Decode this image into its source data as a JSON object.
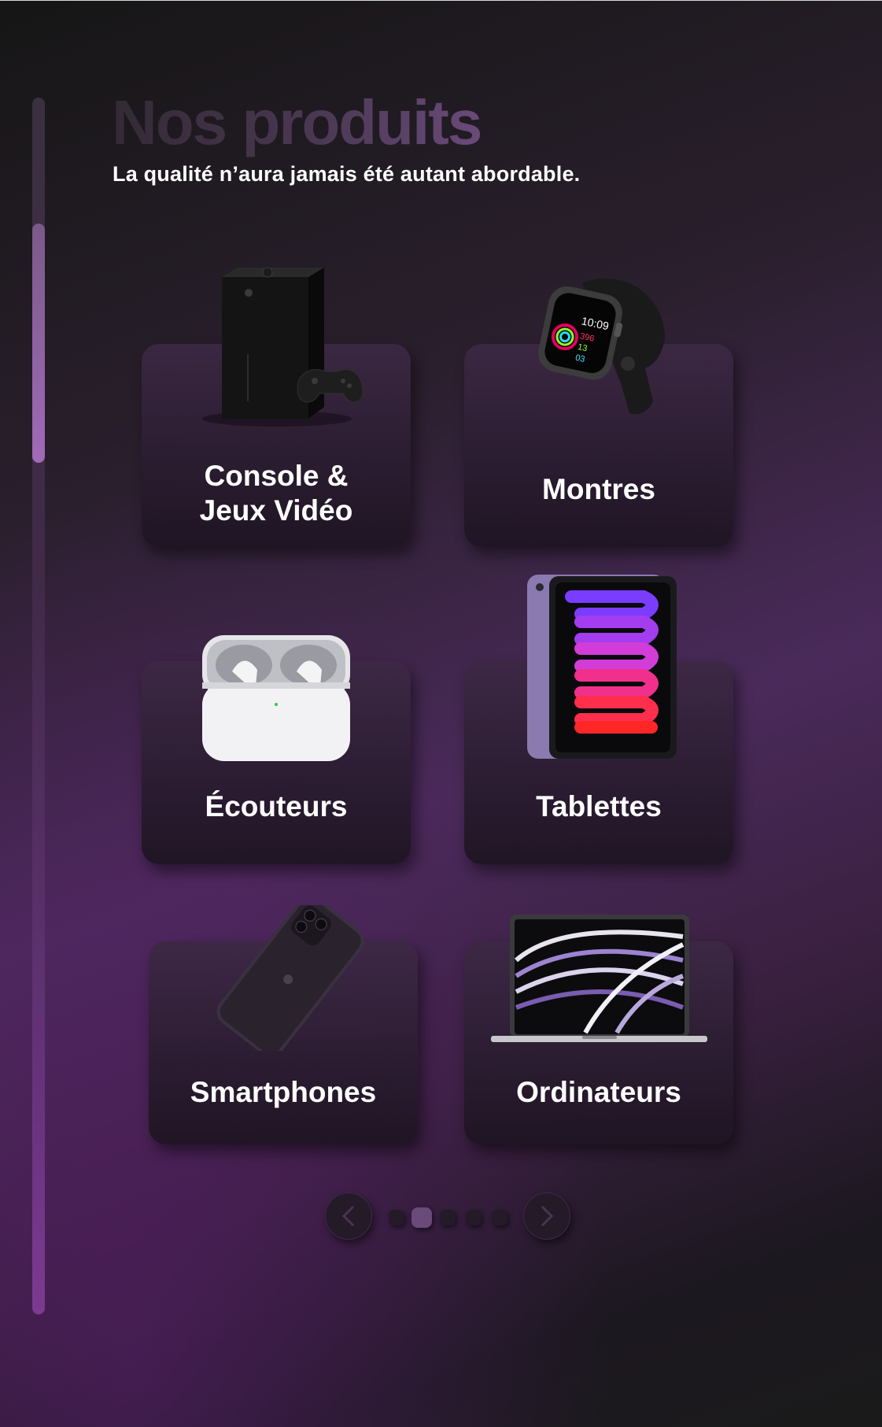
{
  "header": {
    "title": "Nos produits",
    "subtitle": "La qualité n’aura jamais été autant abordable."
  },
  "categories": [
    {
      "label": "Console &\nJeux Vidéo",
      "icon": "game-console-icon"
    },
    {
      "label": "Montres",
      "icon": "smartwatch-icon"
    },
    {
      "label": "Écouteurs",
      "icon": "earbuds-icon"
    },
    {
      "label": "Tablettes",
      "icon": "tablet-icon"
    },
    {
      "label": "Smartphones",
      "icon": "smartphone-icon"
    },
    {
      "label": "Ordinateurs",
      "icon": "laptop-icon"
    }
  ],
  "pagination": {
    "pages": 5,
    "current": 2,
    "prev_icon": "chevron-left-icon",
    "next_icon": "chevron-right-icon"
  },
  "watch_screen": {
    "time": "10:09",
    "move": "396",
    "exercise": "13",
    "stand": "03"
  },
  "colors": {
    "accent": "#a06ab8",
    "card_bg": "#2a1d30",
    "text": "#ffffff"
  }
}
